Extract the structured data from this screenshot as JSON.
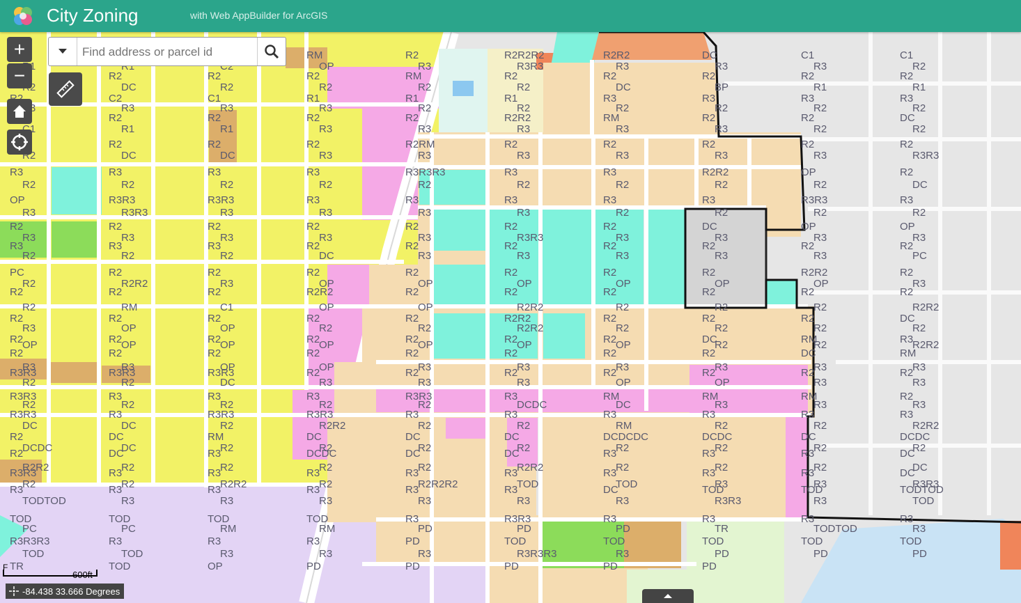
{
  "app": {
    "title": "City Zoning",
    "subtitle": "with Web AppBuilder for ArcGIS"
  },
  "search": {
    "placeholder": "Find address or parcel id"
  },
  "controls": {
    "zoom_in": "+",
    "zoom_out": "−",
    "home_icon": "home-icon",
    "locate_icon": "crosshair-icon",
    "measure_icon": "ruler-icon"
  },
  "scalebar": {
    "label": "600ft",
    "prefix": "F"
  },
  "coordinates": {
    "text": "-84.438 33.666 Degrees"
  },
  "colors": {
    "header": "#2ba58b",
    "R2": "#f2f266",
    "R3": "#f5dcb2",
    "RM": "#dcae6a",
    "DC": "#f5a9e6",
    "OP": "#7ff2dc",
    "PC": "#8cdc5a",
    "TOD": "#e3d4f5",
    "PD": "#e3f5d1",
    "C1": "#e0f5f0",
    "C2": "#f0855a",
    "R1": "#f5f0c8",
    "BP": "#8cc8f0",
    "TR": "#c9e3f5"
  },
  "zoning_labels": [
    "R2",
    "R2R2",
    "R2R2",
    "RM",
    "R2",
    "R2R2R2",
    "R2R2",
    "DC",
    "C1",
    "C1",
    "R1",
    "R1",
    "C2",
    "OP",
    "R3",
    "R3R3",
    "R3",
    "R3",
    "R3",
    "R2",
    "R2",
    "R2",
    "R2",
    "R2",
    "RM",
    "R2",
    "R2",
    "R2",
    "R2",
    "R2",
    "R2",
    "DC",
    "R2",
    "R2",
    "R2",
    "R2",
    "DC",
    "BP",
    "R1",
    "R1",
    "R2",
    "C2",
    "C1",
    "R1",
    "R1",
    "R1",
    "R3",
    "R3",
    "R3",
    "R3",
    "R3",
    "R3",
    "R3",
    "R3",
    "R2",
    "R2",
    "R2",
    "R2",
    "R2",
    "R2",
    "R2",
    "R2",
    "R2",
    "R2",
    "R2",
    "R2R2",
    "RM",
    "R2",
    "R2",
    "DC",
    "C1",
    "R1",
    "R1",
    "R3",
    "R3",
    "R3",
    "R3",
    "R3",
    "R2",
    "R2",
    "R2",
    "R2",
    "R2",
    "R2",
    "R2RM",
    "R2",
    "R2",
    "R2",
    "R2",
    "R2",
    "R2",
    "DC",
    "DC",
    "R3",
    "R3",
    "R3",
    "R3",
    "R3",
    "R3",
    "R3R3",
    "R3",
    "R3",
    "R3",
    "R3",
    "R3R3R3",
    "R3",
    "R3",
    "R2R2",
    "OP",
    "R2",
    "R2",
    "R2",
    "R2",
    "R2",
    "R2",
    "R2",
    "R2",
    "R2",
    "R2",
    "DC",
    "OP",
    "R3R3",
    "R3R3",
    "R3",
    "R3",
    "R3",
    "R3",
    "R3",
    "R3R3",
    "R3",
    "R3",
    "R3R3",
    "R3",
    "R3",
    "R3",
    "R3",
    "R2",
    "R2",
    "R2",
    "R2",
    "R2",
    "R2",
    "R2",
    "R2",
    "R2",
    "R2",
    "R2",
    "DC",
    "OP",
    "OP",
    "R3",
    "R3",
    "R3",
    "R3",
    "R3",
    "R3R3",
    "R3",
    "R3",
    "R3",
    "R3",
    "R3",
    "R3",
    "R3",
    "R2",
    "R2",
    "R2",
    "R2",
    "R2",
    "R2",
    "R2",
    "R2",
    "R2",
    "R2",
    "DC",
    "R3",
    "R3",
    "R3",
    "R3",
    "R3",
    "PC",
    "PC",
    "R2",
    "R2",
    "R2",
    "R2",
    "R2",
    "R2",
    "R2",
    "R2R2",
    "R2",
    "R2",
    "R2R2",
    "R3",
    "OP",
    "OP",
    "OP",
    "OP",
    "OP",
    "OP",
    "R3",
    "R2",
    "R2",
    "R2",
    "R2R2",
    "R2",
    "R2",
    "R2",
    "R2",
    "R2",
    "R2",
    "R2",
    "RM",
    "C1",
    "OP",
    "OP",
    "R2R2",
    "R2",
    "R2",
    "R2",
    "R2R2",
    "R2",
    "R2",
    "R2",
    "R2",
    "R2",
    "R2R2",
    "R2",
    "R2",
    "R2",
    "DC",
    "R3",
    "OP",
    "OP",
    "R2",
    "R2",
    "R2R2",
    "R2",
    "R2",
    "R2",
    "R2",
    "R2",
    "R2",
    "R2",
    "R2",
    "R2",
    "R2",
    "R2",
    "DC",
    "RM",
    "R3",
    "OP",
    "OP",
    "OP",
    "OP",
    "OP",
    "OP",
    "OP",
    "R2",
    "R2",
    "R2R2",
    "R2",
    "R2",
    "R2",
    "R2",
    "R2",
    "R2",
    "R2",
    "R2",
    "DC",
    "RM",
    "R3",
    "R3",
    "OP",
    "OP",
    "R3",
    "R3",
    "R3",
    "R3",
    "R3",
    "R3",
    "R3R3",
    "R3R3",
    "R3R3",
    "R2",
    "R2",
    "R2",
    "R2",
    "R2",
    "R2",
    "R2",
    "R2",
    "R2",
    "DC",
    "R3",
    "R3",
    "R3",
    "OP",
    "OP",
    "R3",
    "R3",
    "R3R3",
    "R3",
    "R3",
    "R3",
    "R3R3",
    "R3",
    "RM",
    "RM",
    "RM",
    "R2",
    "R2",
    "R2",
    "R2",
    "R2",
    "R2",
    "DCDC",
    "DC",
    "R3",
    "R3",
    "R3",
    "R3R3",
    "R3",
    "R3R3",
    "R3R3",
    "R3",
    "R3",
    "R3",
    "R3",
    "R3",
    "R3",
    "DC",
    "DC",
    "R2",
    "R2R2",
    "R2",
    "R2",
    "RM",
    "R2",
    "R2",
    "R2R2",
    "R2",
    "DC",
    "RM",
    "DC",
    "DC",
    "DC",
    "DCDCDC",
    "DCDC",
    "DC",
    "DCDC",
    "DCDC",
    "DC",
    "R2",
    "R2",
    "R2",
    "R2",
    "R2",
    "R2",
    "R2",
    "R2",
    "R2",
    "DC",
    "R3",
    "DCDC",
    "DC",
    "DC",
    "R3",
    "R3",
    "R3",
    "DC",
    "R2R2",
    "R2",
    "R2",
    "R2",
    "R2",
    "R2R2",
    "R2",
    "R2",
    "R2",
    "DC",
    "R3R3",
    "R3",
    "R3",
    "R3",
    "R3",
    "R3",
    "R3",
    "R3",
    "R3",
    "DC",
    "R2",
    "R2",
    "R2R2",
    "R2",
    "R2R2R2",
    "TOD",
    "TOD",
    "R3",
    "R3",
    "R3R3",
    "R3",
    "R3",
    "R3",
    "R3",
    "R3",
    "R3",
    "DC",
    "TOD",
    "TOD",
    "TODTOD",
    "TODTOD",
    "R3",
    "R3",
    "R3",
    "R3",
    "R3",
    "R3",
    "R3R3",
    "R3",
    "TOD",
    "TOD",
    "TOD",
    "TOD",
    "TOD",
    "R3",
    "R3R3",
    "R3",
    "R3",
    "R3",
    "R3",
    "PC",
    "PC",
    "RM",
    "RM",
    "PD",
    "PD",
    "PD",
    "TR",
    "TODTOD",
    "R3",
    "R3R3R3",
    "R3",
    "R3",
    "R3",
    "PD",
    "TOD",
    "TOD",
    "TOD",
    "TOD",
    "TOD",
    "TOD",
    "TOD",
    "R3",
    "R3",
    "R3",
    "R3R3R3",
    "R3",
    "PD",
    "PD",
    "PD",
    "TR",
    "TOD",
    "OP",
    "PD",
    "PD",
    "PD",
    "PD",
    "PD"
  ]
}
